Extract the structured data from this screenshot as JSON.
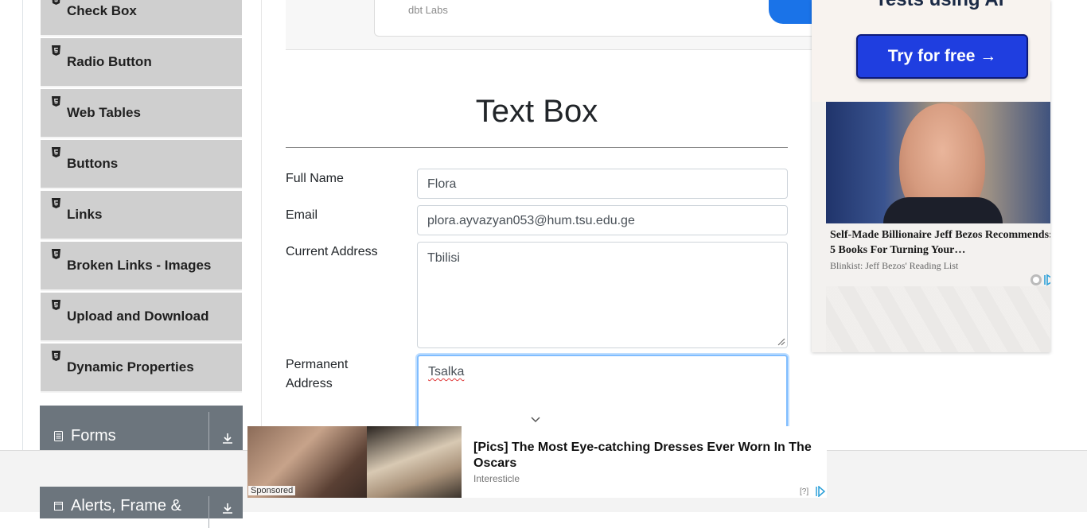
{
  "sidebar": {
    "items": [
      {
        "label": "Check Box"
      },
      {
        "label": "Radio Button"
      },
      {
        "label": "Web Tables"
      },
      {
        "label": "Buttons"
      },
      {
        "label": "Links"
      },
      {
        "label": "Broken Links - Images"
      },
      {
        "label": "Upload and Download"
      },
      {
        "label": "Dynamic Properties"
      }
    ],
    "groups": [
      {
        "label": "Forms"
      },
      {
        "label": "Alerts, Frame &"
      }
    ]
  },
  "banner": {
    "text": "dbt Labs"
  },
  "page": {
    "title": "Text Box"
  },
  "form": {
    "full_name_label": "Full Name",
    "full_name_value": "Flora",
    "email_label": "Email",
    "email_value": "plora.ayvazyan053@hum.tsu.edu.ge",
    "current_address_label": "Current Address",
    "current_address_value": "Tbilisi",
    "permanent_address_label_1": "Permanent",
    "permanent_address_label_2": "Address",
    "permanent_address_value": "Tsalka"
  },
  "right_ad": {
    "tagline": "Tests using AI",
    "cta": "Try for free →",
    "headline": "Self-Made Billionaire Jeff Bezos Recommends: 5 Books For Turning Your…",
    "source": "Blinkist: Jeff Bezos' Reading List"
  },
  "bottom_ad": {
    "sponsored": "Sponsored",
    "headline": "[Pics] The Most Eye-catching Dresses Ever Worn In The Oscars",
    "source": "Interesticle",
    "choice": "[?]"
  },
  "colors": {
    "sidebar_item_bg": "#cfcfcf",
    "group_header_bg": "#6c757d",
    "focus_border": "#80bdff",
    "ad_cta": "#1f3ee0"
  }
}
